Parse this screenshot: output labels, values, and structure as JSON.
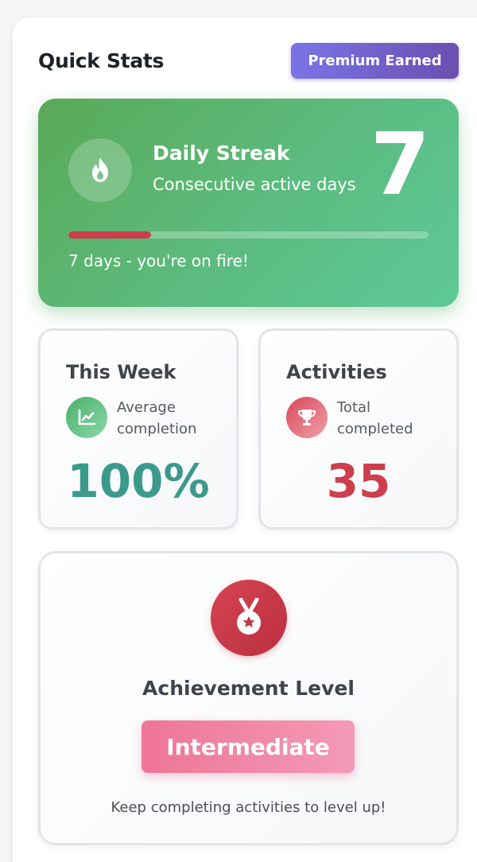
{
  "header": {
    "title": "Quick Stats",
    "badge": "Premium Earned"
  },
  "streak": {
    "title": "Daily Streak",
    "subtitle": "Consecutive active days",
    "count": "7",
    "progress_percent": 23,
    "message": "7 days - you're on fire!",
    "icon": "flame-icon"
  },
  "stats": [
    {
      "title": "This Week",
      "desc": "Average completion",
      "value": "100%",
      "icon": "line-chart-icon",
      "color": "#3b9a8c"
    },
    {
      "title": "Activities",
      "desc": "Total completed",
      "value": "35",
      "icon": "trophy-icon",
      "color": "#cd3f4c"
    }
  ],
  "achievement": {
    "title": "Achievement Level",
    "level": "Intermediate",
    "note": "Keep completing activities to level up!",
    "icon": "medal-icon"
  },
  "colors": {
    "accent_green": "#5cbc80",
    "accent_purple": "#6b4fb0",
    "accent_red": "#cd3f4c",
    "accent_pink": "#ee7598"
  }
}
